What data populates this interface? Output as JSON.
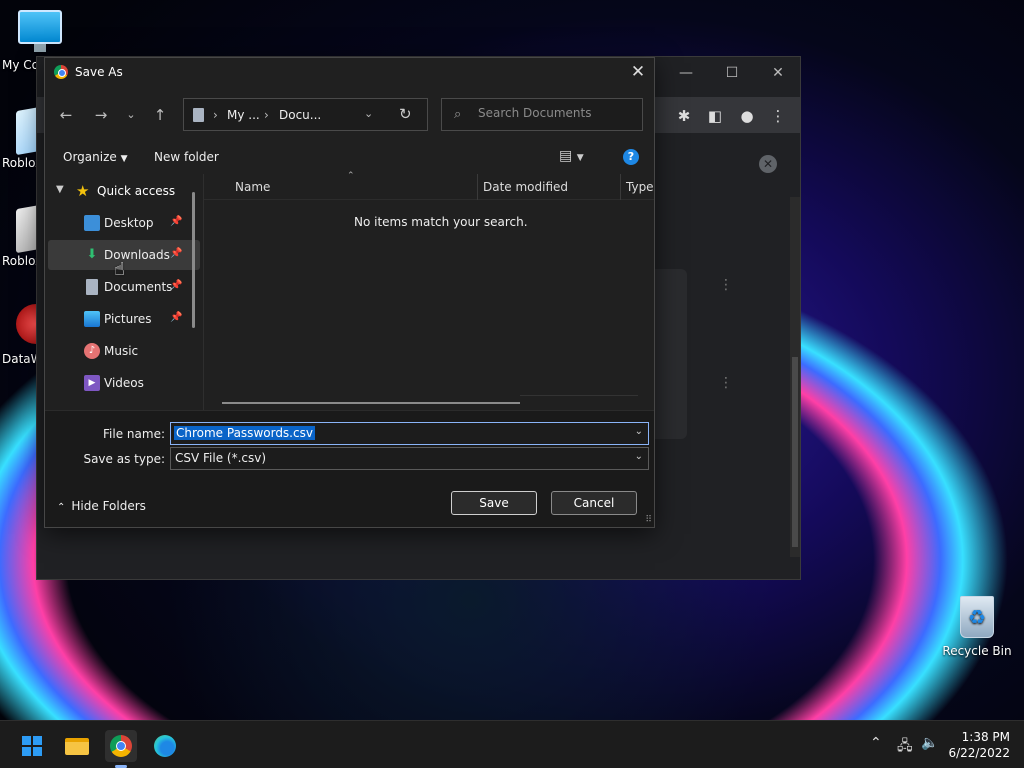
{
  "desktop": {
    "icons": [
      {
        "label": "My Co"
      },
      {
        "label": "Roblox"
      },
      {
        "label": "Roblox"
      },
      {
        "label": "DataW"
      }
    ],
    "recycle_bin": "Recycle Bin"
  },
  "dialog": {
    "title": "Save As",
    "address": {
      "crumb1": "My ...",
      "crumb2": "Docu..."
    },
    "search_placeholder": "Search Documents",
    "commands": {
      "organize": "Organize",
      "new_folder": "New folder"
    },
    "nav": {
      "quick_access": "Quick access",
      "items": [
        {
          "label": "Desktop",
          "pinned": true
        },
        {
          "label": "Downloads",
          "pinned": true
        },
        {
          "label": "Documents",
          "pinned": true
        },
        {
          "label": "Pictures",
          "pinned": true
        },
        {
          "label": "Music",
          "pinned": false
        },
        {
          "label": "Videos",
          "pinned": false
        }
      ]
    },
    "columns": [
      "Name",
      "Date modified",
      "Type"
    ],
    "empty_message": "No items match your search.",
    "file_name_label": "File name:",
    "file_name_value": "Chrome Passwords.csv",
    "save_type_label": "Save as type:",
    "save_type_value": "CSV File (*.csv)",
    "hide_folders": "Hide Folders",
    "save_button": "Save",
    "cancel_button": "Cancel"
  },
  "taskbar": {
    "time": "1:38 PM",
    "date": "6/22/2022"
  },
  "colors": {
    "accent": "#0a64c8",
    "help": "#1e88e5",
    "star": "#f4c20d"
  }
}
